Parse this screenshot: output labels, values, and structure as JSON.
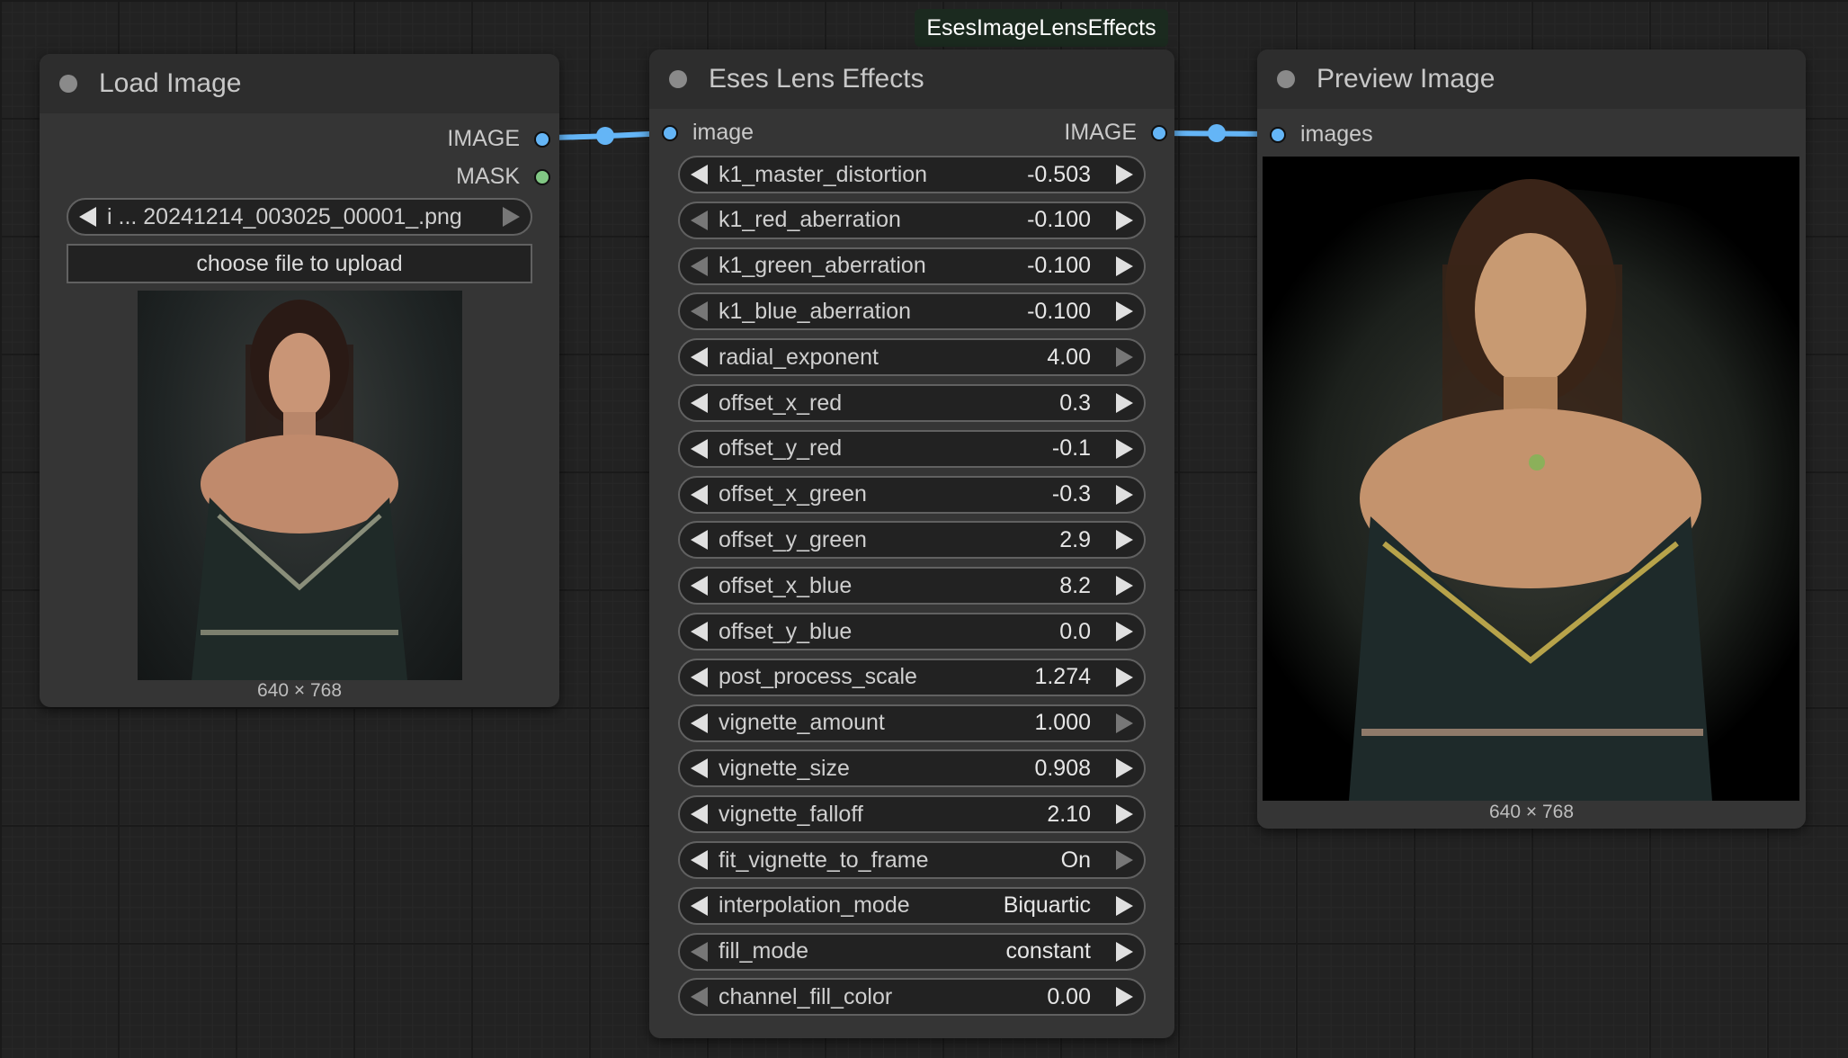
{
  "colors": {
    "canvas": "#222222",
    "node_body": "#353535",
    "node_header": "#2d2d2d",
    "image_socket": "#64b5f6",
    "mask_socket": "#81c784",
    "link": "#64b5f6"
  },
  "node_class_badge": "EsesImageLensEffects",
  "load_image": {
    "title": "Load Image",
    "outputs": [
      "IMAGE",
      "MASK"
    ],
    "file_selector": "i ... 20241214_003025_00001_.png",
    "upload_button": "choose file to upload",
    "preview_caption": "640 × 768"
  },
  "lens_effects": {
    "title": "Eses Lens Effects",
    "input_label": "image",
    "output_label": "IMAGE",
    "widgets": [
      {
        "label": "k1_master_distortion",
        "value": "-0.503",
        "left_dim": false,
        "right_dim": false
      },
      {
        "label": "k1_red_aberration",
        "value": "-0.100",
        "left_dim": true,
        "right_dim": false
      },
      {
        "label": "k1_green_aberration",
        "value": "-0.100",
        "left_dim": true,
        "right_dim": false
      },
      {
        "label": "k1_blue_aberration",
        "value": "-0.100",
        "left_dim": true,
        "right_dim": false
      },
      {
        "label": "radial_exponent",
        "value": "4.00",
        "left_dim": false,
        "right_dim": true
      },
      {
        "label": "offset_x_red",
        "value": "0.3",
        "left_dim": false,
        "right_dim": false
      },
      {
        "label": "offset_y_red",
        "value": "-0.1",
        "left_dim": false,
        "right_dim": false
      },
      {
        "label": "offset_x_green",
        "value": "-0.3",
        "left_dim": false,
        "right_dim": false
      },
      {
        "label": "offset_y_green",
        "value": "2.9",
        "left_dim": false,
        "right_dim": false
      },
      {
        "label": "offset_x_blue",
        "value": "8.2",
        "left_dim": false,
        "right_dim": false
      },
      {
        "label": "offset_y_blue",
        "value": "0.0",
        "left_dim": false,
        "right_dim": false
      },
      {
        "label": "post_process_scale",
        "value": "1.274",
        "left_dim": false,
        "right_dim": false
      },
      {
        "label": "vignette_amount",
        "value": "1.000",
        "left_dim": false,
        "right_dim": true
      },
      {
        "label": "vignette_size",
        "value": "0.908",
        "left_dim": false,
        "right_dim": false
      },
      {
        "label": "vignette_falloff",
        "value": "2.10",
        "left_dim": false,
        "right_dim": false
      },
      {
        "label": "fit_vignette_to_frame",
        "value": "On",
        "left_dim": false,
        "right_dim": true
      },
      {
        "label": "interpolation_mode",
        "value": "Biquartic",
        "left_dim": false,
        "right_dim": false
      },
      {
        "label": "fill_mode",
        "value": "constant",
        "left_dim": true,
        "right_dim": false
      },
      {
        "label": "channel_fill_color",
        "value": "0.00",
        "left_dim": true,
        "right_dim": false
      }
    ]
  },
  "preview_image": {
    "title": "Preview Image",
    "input_label": "images",
    "preview_caption": "640 × 768"
  }
}
